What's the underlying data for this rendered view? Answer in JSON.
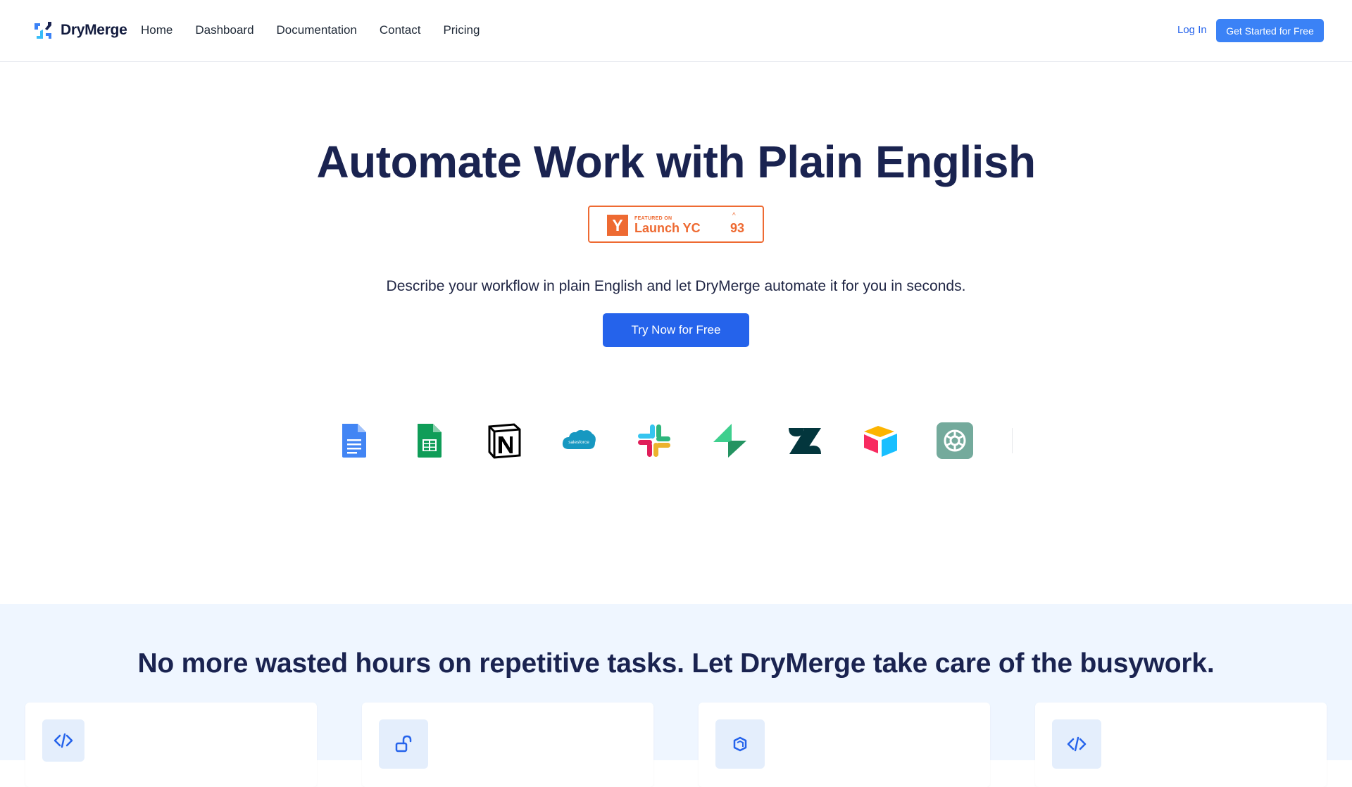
{
  "header": {
    "brand": "DryMerge",
    "nav": [
      {
        "label": "Home"
      },
      {
        "label": "Dashboard"
      },
      {
        "label": "Documentation"
      },
      {
        "label": "Contact"
      },
      {
        "label": "Pricing"
      }
    ],
    "login_label": "Log In",
    "cta_label": "Get Started for Free"
  },
  "hero": {
    "title": "Automate Work with Plain English",
    "badge": {
      "logo": "Y",
      "featured_text": "FEATURED ON",
      "name": "Launch YC",
      "votes": "93",
      "arrow": "^"
    },
    "subtitle": "Describe your workflow in plain English and let DryMerge automate it for you in seconds.",
    "cta_label": "Try Now for Free"
  },
  "integrations": [
    {
      "icon": "google-docs-icon"
    },
    {
      "icon": "google-sheets-icon"
    },
    {
      "icon": "notion-icon"
    },
    {
      "icon": "salesforce-icon",
      "text": "salesforce"
    },
    {
      "icon": "slack-icon"
    },
    {
      "icon": "supabase-icon"
    },
    {
      "icon": "zendesk-icon"
    },
    {
      "icon": "airtable-icon"
    },
    {
      "icon": "openai-icon"
    }
  ],
  "features": {
    "title": "No more wasted hours on repetitive tasks. Let DryMerge take care of the busywork.",
    "cards": [
      {
        "icon": "code-icon"
      },
      {
        "icon": "unlock-icon"
      },
      {
        "icon": "cubes-icon"
      },
      {
        "icon": "code-icon"
      }
    ]
  },
  "colors": {
    "primary": "#2563eb",
    "accent_light": "#3b82f6",
    "heading": "#1a2350",
    "yc_orange": "#ee6a32",
    "section_bg": "#eff6ff"
  }
}
